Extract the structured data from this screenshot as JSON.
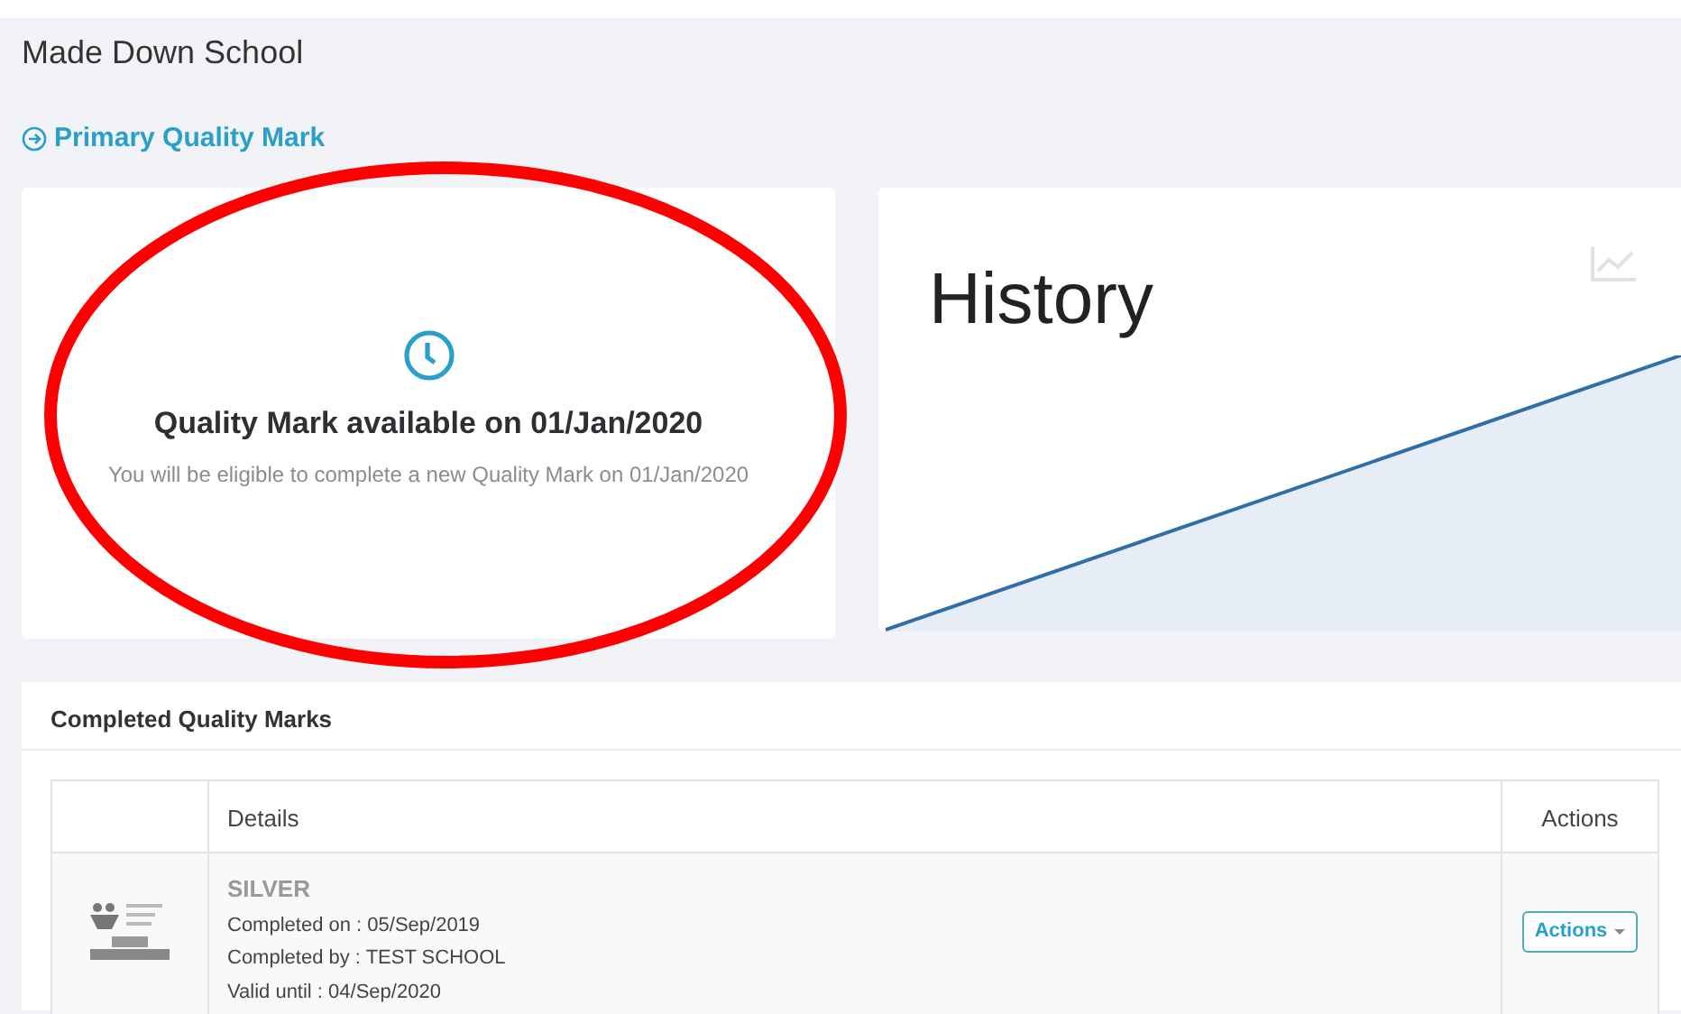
{
  "page": {
    "title": "Made Down School",
    "section_link": "Primary Quality Mark"
  },
  "status_card": {
    "heading": "Quality Mark available on 01/Jan/2020",
    "message": "You will be eligible to complete a new Quality Mark on 01/Jan/2020"
  },
  "history_card": {
    "title": "History"
  },
  "completed": {
    "title": "Completed Quality Marks",
    "columns": [
      "Details",
      "Actions"
    ],
    "rows": [
      {
        "level": "SILVER",
        "completed_on": "Completed on : 05/Sep/2019",
        "completed_by": "Completed by : TEST SCHOOL",
        "valid_until": "Valid until : 04/Sep/2020",
        "action": "Actions"
      }
    ]
  },
  "annotations": [
    {
      "kind": "ellipse"
    }
  ]
}
